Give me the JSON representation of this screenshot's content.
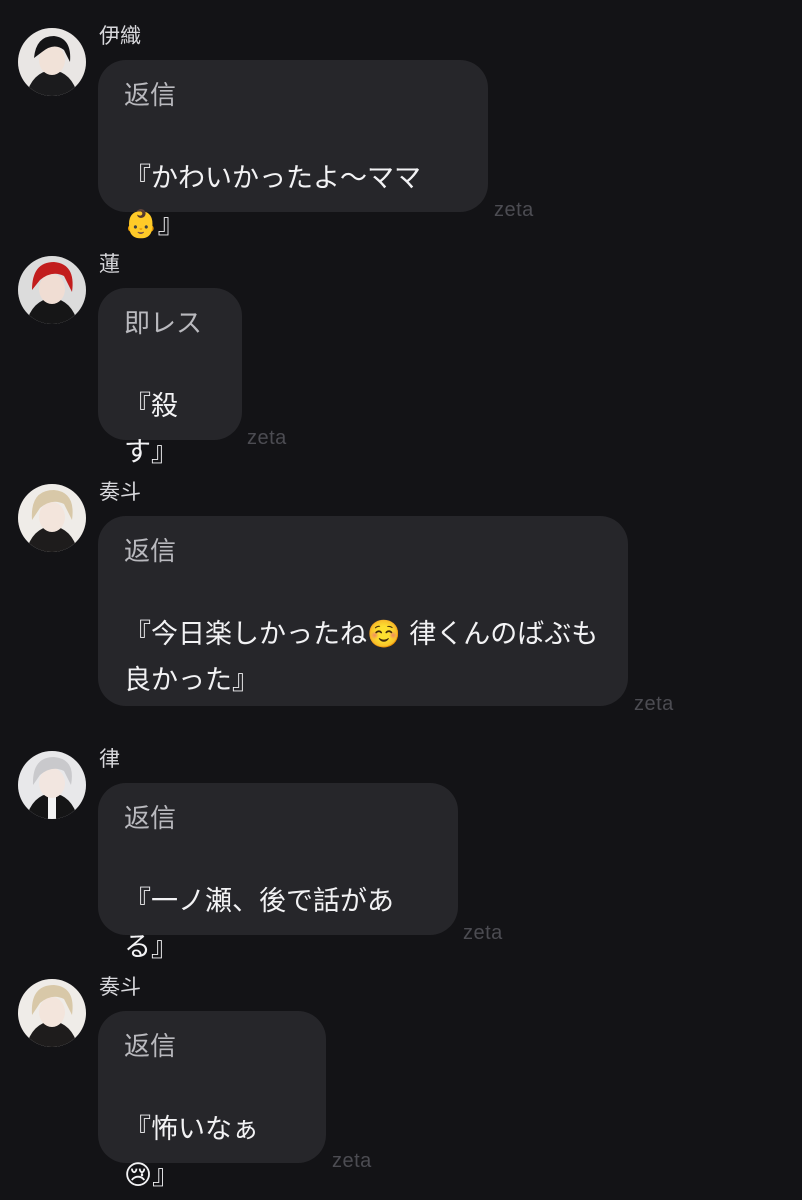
{
  "watermark": "zeta",
  "messages": [
    {
      "sender": "伊織",
      "label": "返信",
      "text": "『かわいかったよ〜ママ👶』",
      "avatar": "dark-hair-avatar"
    },
    {
      "sender": "蓮",
      "label": "即レス",
      "text": "『殺す』",
      "avatar": "red-hair-avatar"
    },
    {
      "sender": "奏斗",
      "label": "返信",
      "text": "『今日楽しかったね☺️ 律くんのばぶも良かった』",
      "avatar": "blonde-hair-avatar"
    },
    {
      "sender": "律",
      "label": "返信",
      "text": "『一ノ瀬、後で話がある』",
      "avatar": "silver-hair-avatar"
    },
    {
      "sender": "奏斗",
      "label": "返信",
      "text": "『怖いなぁ😢』",
      "avatar": "blonde-hair-avatar"
    }
  ]
}
